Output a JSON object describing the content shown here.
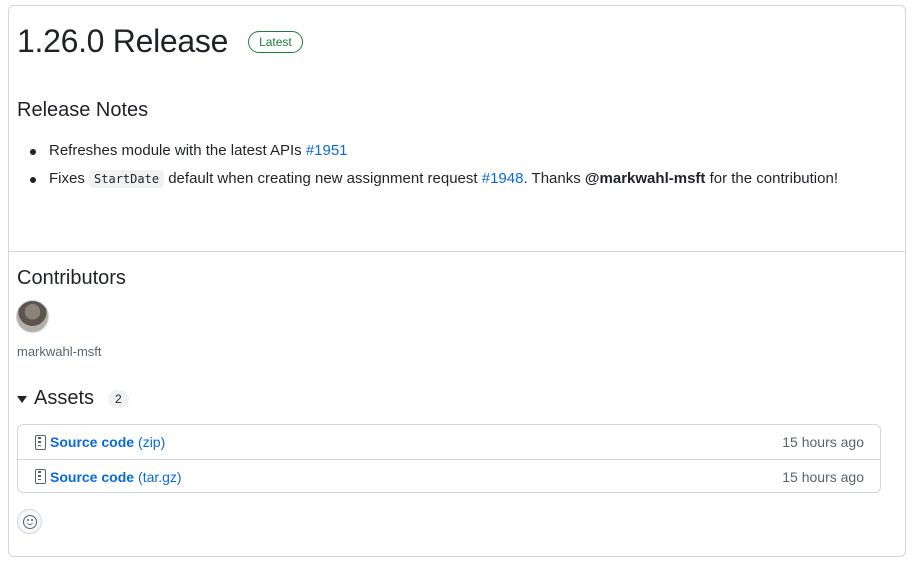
{
  "release": {
    "title": "1.26.0 Release",
    "badge": "Latest"
  },
  "notes": {
    "heading": "Release Notes",
    "item1": {
      "text": "Refreshes module with the latest APIs",
      "link": "#1951"
    },
    "item2": {
      "prefix": "Fixes",
      "code": "StartDate",
      "middle": "default when creating new assignment request",
      "link": "#1948",
      "thanks": ". Thanks",
      "user": "@markwahl-msft",
      "suffix": "for the contribution!"
    }
  },
  "contributors": {
    "heading": "Contributors",
    "name": "markwahl-msft"
  },
  "assets": {
    "heading": "Assets",
    "count": "2",
    "items": [
      {
        "name": "Source code",
        "ext": "(zip)",
        "time": "15 hours ago"
      },
      {
        "name": "Source code",
        "ext": "(tar.gz)",
        "time": "15 hours ago"
      }
    ]
  },
  "colors": {
    "link": "#0969da",
    "badge": "#1a7f37",
    "border": "#d0d7de"
  }
}
